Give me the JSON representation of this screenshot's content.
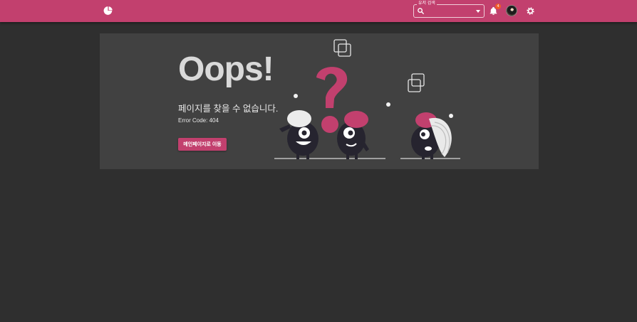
{
  "header": {
    "search": {
      "label": "유저 검색",
      "value": "",
      "placeholder": ""
    },
    "notifications": {
      "count": "4"
    },
    "logo_icon": "pie-chart-icon",
    "settings_icon": "gear-icon"
  },
  "error": {
    "title": "Oops!",
    "message": "페이지를 찾을 수 없습니다.",
    "code_text": "Error Code: 404",
    "button_label": "메인페이지로 이동"
  },
  "colors": {
    "brand": "#c2406e",
    "background": "#2f2f2f",
    "card": "#414141",
    "badge": "#f05a2a"
  }
}
